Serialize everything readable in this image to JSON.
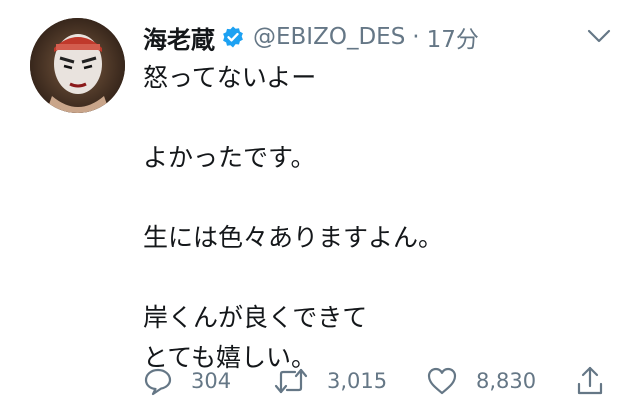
{
  "tweet": {
    "display_name": "海老蔵",
    "handle": "@EBIZO_DES",
    "separator": "·",
    "time": "17分",
    "lines": [
      "怒ってないよー",
      "",
      "よかったです。",
      "",
      "生には色々ありますよん。",
      "",
      "岸くんが良くできて",
      "とても嬉しい。"
    ]
  },
  "actions": {
    "reply_count": "304",
    "retweet_count": "3,015",
    "like_count": "8,830"
  },
  "icons": {
    "verified": "verified-badge-icon",
    "menu": "chevron-down-icon",
    "reply": "reply-icon",
    "retweet": "retweet-icon",
    "like": "heart-icon",
    "share": "share-icon"
  },
  "colors": {
    "verified": "#1da1f2",
    "secondary_text": "#657786",
    "primary_text": "#14171a"
  }
}
